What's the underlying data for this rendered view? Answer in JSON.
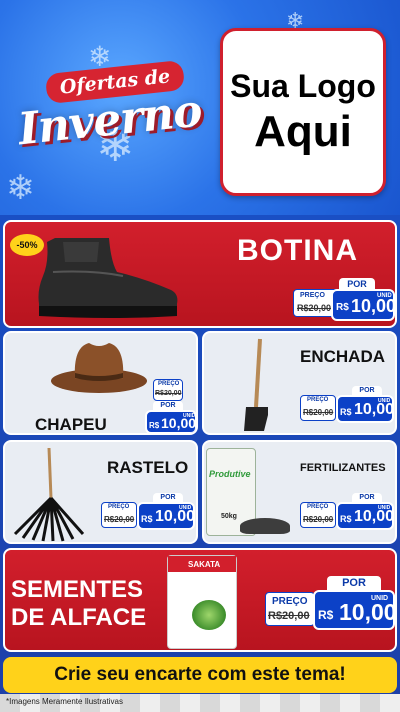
{
  "header": {
    "title_top": "Ofertas de",
    "title_main": "Inverno",
    "logo_line1": "Sua Logo",
    "logo_line2": "Aqui"
  },
  "products": {
    "botina": {
      "name": "BOTINA",
      "badge": "-50%",
      "preco_label": "PREÇO",
      "old_price": "R$20,00",
      "por_label": "POR",
      "currency": "R$",
      "price": "10,00",
      "unid": "UNID"
    },
    "chapeu": {
      "name": "CHAPEU",
      "preco_label": "PREÇO",
      "old_price": "R$20,00",
      "por_label": "POR",
      "currency": "R$",
      "price": "10,00",
      "unid": "UNID"
    },
    "enchada": {
      "name": "ENCHADA",
      "preco_label": "PREÇO",
      "old_price": "R$20,00",
      "por_label": "POR",
      "currency": "R$",
      "price": "10,00",
      "unid": "UNID"
    },
    "rastelo": {
      "name": "RASTELO",
      "preco_label": "PREÇO",
      "old_price": "R$20,00",
      "por_label": "POR",
      "currency": "R$",
      "price": "10,00",
      "unid": "UNID"
    },
    "fertilizantes": {
      "name": "FERTILIZANTES",
      "preco_label": "PREÇO",
      "old_price": "R$20,00",
      "por_label": "POR",
      "currency": "R$",
      "price": "10,00",
      "unid": "UNID",
      "bag_brand": "Produtive",
      "bag_weight": "50kg"
    },
    "sementes": {
      "name_line1": "SEMENTES",
      "name_line2": "DE ALFACE",
      "preco_label": "PREÇO",
      "old_price": "R$20,00",
      "por_label": "POR",
      "currency": "R$",
      "price": "10,00",
      "unid": "UNID",
      "pack_brand": "SAKATA"
    }
  },
  "banner": {
    "text": "Crie seu encarte com este tema!"
  },
  "footer": {
    "note": "*Imagens Meramente Ilustrativas"
  },
  "colors": {
    "red": "#d21f2c",
    "blue": "#0c41c7",
    "yellow": "#ffd21a"
  }
}
